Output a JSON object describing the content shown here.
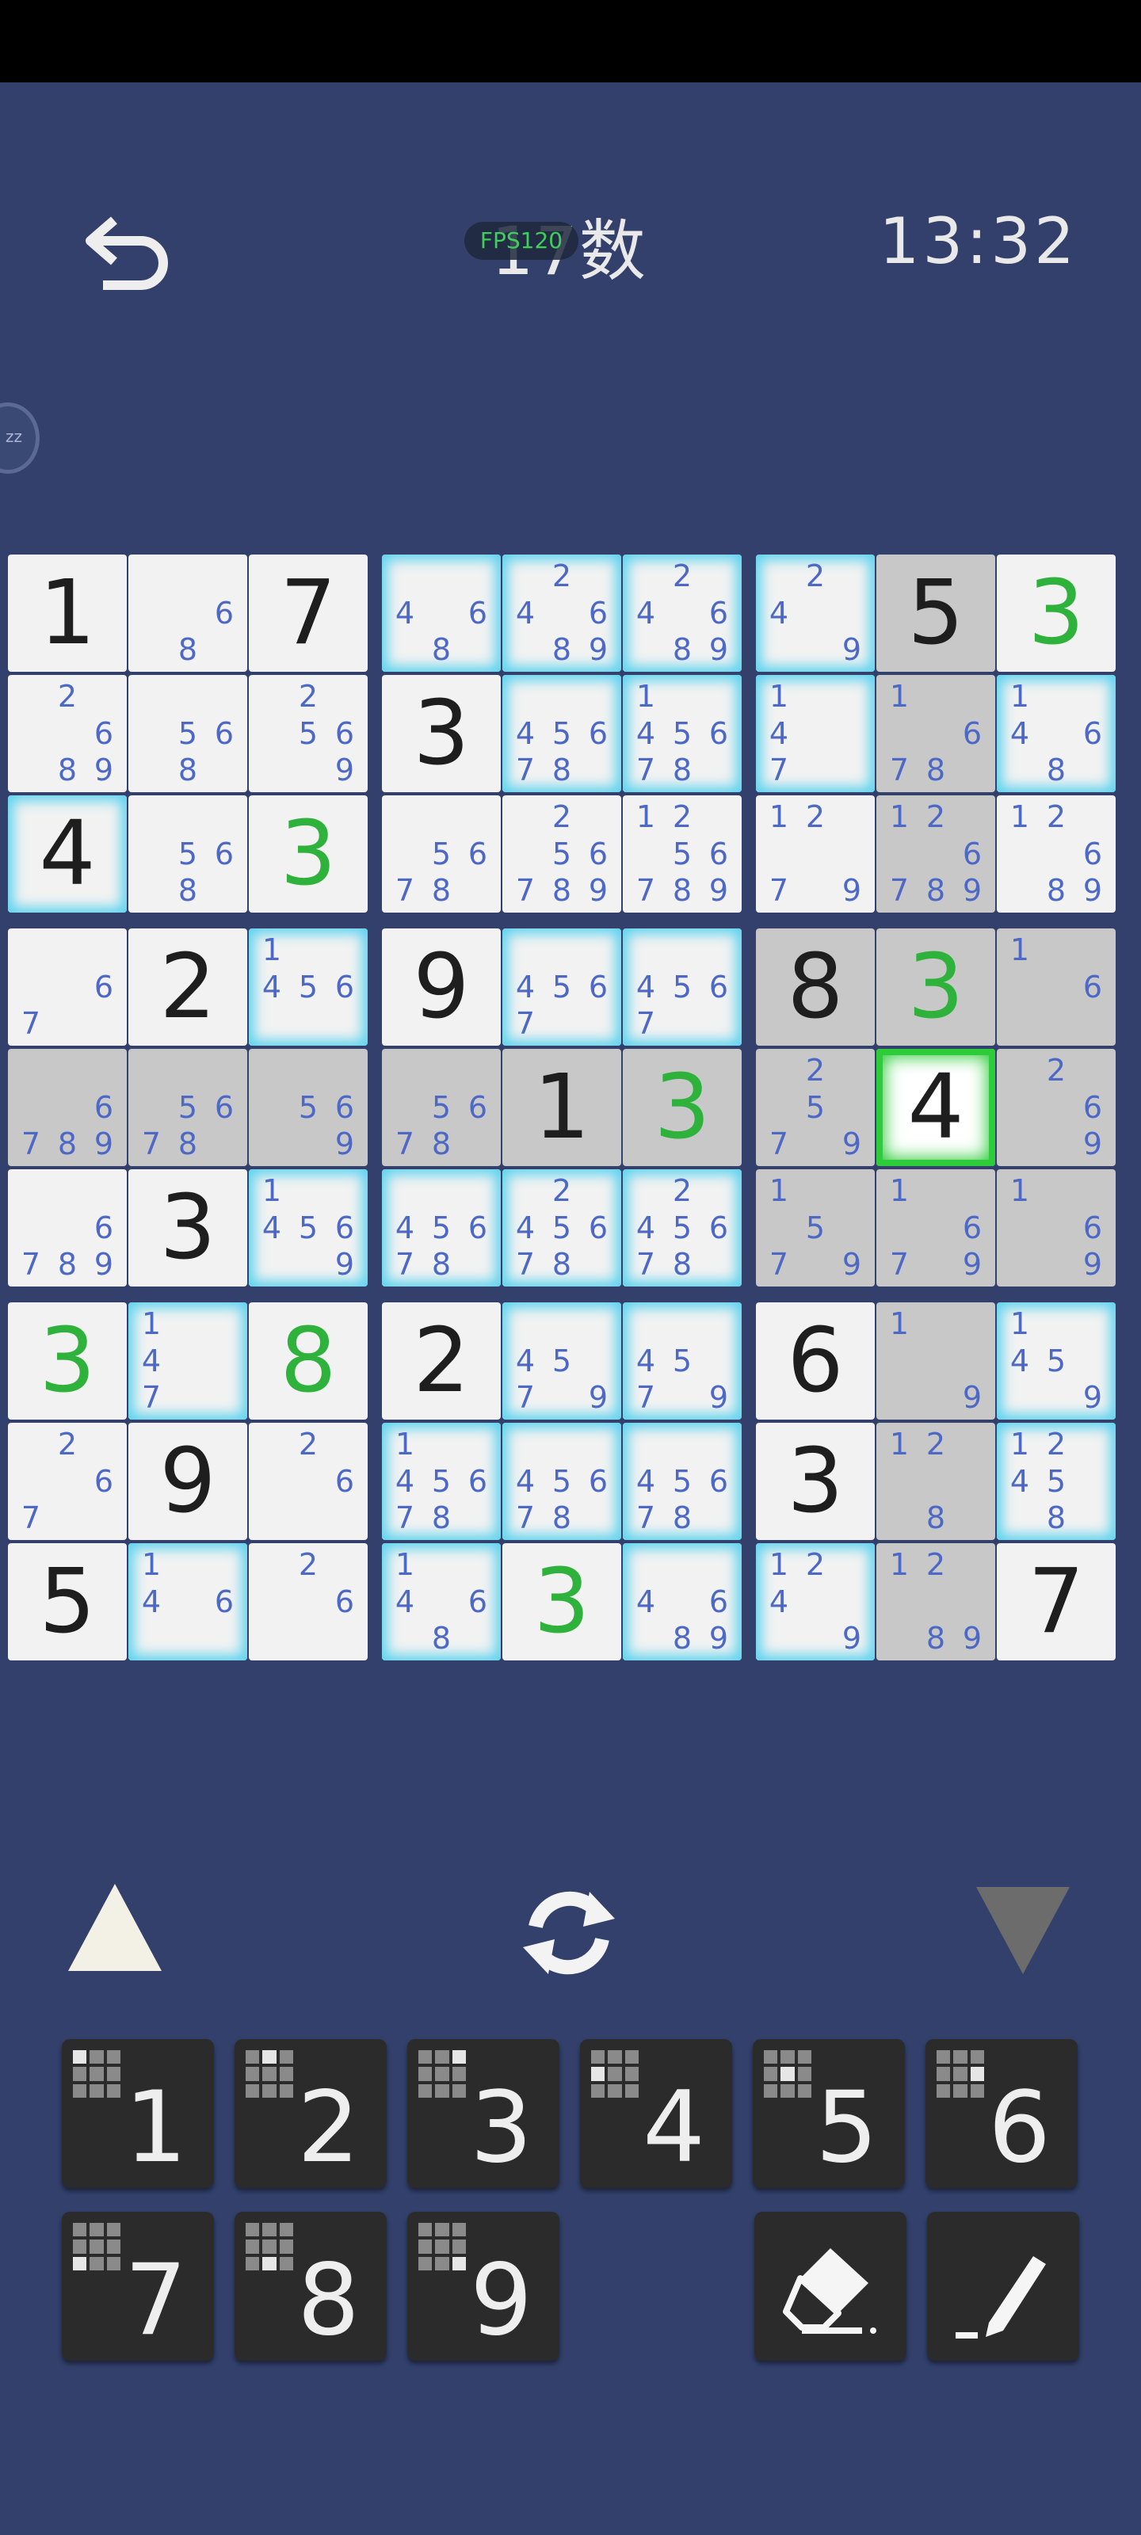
{
  "header": {
    "title": "17数",
    "fps_badge": "FPS120",
    "timer": "13:32",
    "side_badge": "zz"
  },
  "board": {
    "cells": [
      {
        "v": "1",
        "g": false,
        "h": false,
        "grey": false,
        "notes": []
      },
      {
        "v": "",
        "g": false,
        "h": false,
        "grey": false,
        "notes": [
          6,
          8
        ]
      },
      {
        "v": "7",
        "g": false,
        "h": false,
        "grey": false,
        "notes": []
      },
      {
        "v": "",
        "g": false,
        "h": true,
        "grey": false,
        "notes": [
          4,
          6,
          8
        ]
      },
      {
        "v": "",
        "g": false,
        "h": true,
        "grey": false,
        "notes": [
          2,
          4,
          6,
          8,
          9
        ]
      },
      {
        "v": "",
        "g": false,
        "h": true,
        "grey": false,
        "notes": [
          2,
          4,
          6,
          8,
          9
        ]
      },
      {
        "v": "",
        "g": false,
        "h": true,
        "grey": false,
        "notes": [
          2,
          4,
          9
        ]
      },
      {
        "v": "5",
        "g": false,
        "h": false,
        "grey": true,
        "notes": []
      },
      {
        "v": "3",
        "g": true,
        "h": false,
        "grey": false,
        "notes": []
      },
      {
        "v": "",
        "g": false,
        "h": false,
        "grey": false,
        "notes": [
          2,
          6,
          8,
          9
        ]
      },
      {
        "v": "",
        "g": false,
        "h": false,
        "grey": false,
        "notes": [
          5,
          6,
          8
        ]
      },
      {
        "v": "",
        "g": false,
        "h": false,
        "grey": false,
        "notes": [
          2,
          5,
          6,
          9
        ]
      },
      {
        "v": "3",
        "g": false,
        "h": false,
        "grey": false,
        "notes": []
      },
      {
        "v": "",
        "g": false,
        "h": true,
        "grey": false,
        "notes": [
          4,
          5,
          6,
          7,
          8
        ]
      },
      {
        "v": "",
        "g": false,
        "h": true,
        "grey": false,
        "notes": [
          1,
          4,
          5,
          6,
          7,
          8
        ]
      },
      {
        "v": "",
        "g": false,
        "h": true,
        "grey": false,
        "notes": [
          1,
          4,
          7
        ]
      },
      {
        "v": "",
        "g": false,
        "h": false,
        "grey": true,
        "notes": [
          1,
          6,
          7,
          8
        ]
      },
      {
        "v": "",
        "g": false,
        "h": true,
        "grey": false,
        "notes": [
          1,
          4,
          6,
          8
        ]
      },
      {
        "v": "4",
        "g": false,
        "h": true,
        "grey": false,
        "notes": []
      },
      {
        "v": "",
        "g": false,
        "h": false,
        "grey": false,
        "notes": [
          5,
          6,
          8
        ]
      },
      {
        "v": "3",
        "g": true,
        "h": false,
        "grey": false,
        "notes": []
      },
      {
        "v": "",
        "g": false,
        "h": false,
        "grey": false,
        "notes": [
          5,
          6,
          7,
          8
        ]
      },
      {
        "v": "",
        "g": false,
        "h": false,
        "grey": false,
        "notes": [
          2,
          5,
          6,
          7,
          8,
          9
        ]
      },
      {
        "v": "",
        "g": false,
        "h": false,
        "grey": false,
        "notes": [
          1,
          2,
          5,
          6,
          7,
          8,
          9
        ]
      },
      {
        "v": "",
        "g": false,
        "h": false,
        "grey": false,
        "notes": [
          1,
          2,
          7,
          9
        ]
      },
      {
        "v": "",
        "g": false,
        "h": false,
        "grey": true,
        "notes": [
          1,
          2,
          6,
          7,
          8,
          9
        ]
      },
      {
        "v": "",
        "g": false,
        "h": false,
        "grey": false,
        "notes": [
          1,
          2,
          6,
          8,
          9
        ]
      },
      {
        "v": "",
        "g": false,
        "h": false,
        "grey": false,
        "notes": [
          6,
          7
        ]
      },
      {
        "v": "2",
        "g": false,
        "h": false,
        "grey": false,
        "notes": []
      },
      {
        "v": "",
        "g": false,
        "h": true,
        "grey": false,
        "notes": [
          1,
          4,
          5,
          6
        ]
      },
      {
        "v": "9",
        "g": false,
        "h": false,
        "grey": false,
        "notes": []
      },
      {
        "v": "",
        "g": false,
        "h": true,
        "grey": false,
        "notes": [
          4,
          5,
          6,
          7
        ]
      },
      {
        "v": "",
        "g": false,
        "h": true,
        "grey": false,
        "notes": [
          4,
          5,
          6,
          7
        ]
      },
      {
        "v": "8",
        "g": false,
        "h": false,
        "grey": true,
        "notes": []
      },
      {
        "v": "3",
        "g": true,
        "h": false,
        "grey": true,
        "notes": []
      },
      {
        "v": "",
        "g": false,
        "h": false,
        "grey": true,
        "notes": [
          1,
          6
        ]
      },
      {
        "v": "",
        "g": false,
        "h": false,
        "grey": true,
        "notes": [
          6,
          7,
          8,
          9
        ]
      },
      {
        "v": "",
        "g": false,
        "h": false,
        "grey": true,
        "notes": [
          5,
          6,
          7,
          8
        ]
      },
      {
        "v": "",
        "g": false,
        "h": false,
        "grey": true,
        "notes": [
          5,
          6,
          9
        ]
      },
      {
        "v": "",
        "g": false,
        "h": false,
        "grey": true,
        "notes": [
          5,
          6,
          7,
          8
        ]
      },
      {
        "v": "1",
        "g": false,
        "h": false,
        "grey": true,
        "notes": []
      },
      {
        "v": "3",
        "g": true,
        "h": false,
        "grey": true,
        "notes": []
      },
      {
        "v": "",
        "g": false,
        "h": false,
        "grey": true,
        "notes": [
          2,
          5,
          7,
          9
        ]
      },
      {
        "v": "4",
        "g": false,
        "h": false,
        "grey": false,
        "sel": true,
        "notes": []
      },
      {
        "v": "",
        "g": false,
        "h": false,
        "grey": true,
        "notes": [
          2,
          6,
          9
        ]
      },
      {
        "v": "",
        "g": false,
        "h": false,
        "grey": false,
        "notes": [
          6,
          7,
          8,
          9
        ]
      },
      {
        "v": "3",
        "g": false,
        "h": false,
        "grey": false,
        "notes": []
      },
      {
        "v": "",
        "g": false,
        "h": true,
        "grey": false,
        "notes": [
          1,
          4,
          5,
          6,
          9
        ]
      },
      {
        "v": "",
        "g": false,
        "h": true,
        "grey": false,
        "notes": [
          4,
          5,
          6,
          7,
          8
        ]
      },
      {
        "v": "",
        "g": false,
        "h": true,
        "grey": false,
        "notes": [
          2,
          4,
          5,
          6,
          7,
          8
        ]
      },
      {
        "v": "",
        "g": false,
        "h": true,
        "grey": false,
        "notes": [
          2,
          4,
          5,
          6,
          7,
          8
        ]
      },
      {
        "v": "",
        "g": false,
        "h": false,
        "grey": true,
        "notes": [
          1,
          5,
          7,
          9
        ]
      },
      {
        "v": "",
        "g": false,
        "h": false,
        "grey": true,
        "notes": [
          1,
          6,
          7,
          9
        ]
      },
      {
        "v": "",
        "g": false,
        "h": false,
        "grey": true,
        "notes": [
          1,
          6,
          9
        ]
      },
      {
        "v": "3",
        "g": true,
        "h": false,
        "grey": false,
        "notes": []
      },
      {
        "v": "",
        "g": false,
        "h": true,
        "grey": false,
        "notes": [
          1,
          4,
          7
        ]
      },
      {
        "v": "8",
        "g": true,
        "h": false,
        "grey": false,
        "notes": []
      },
      {
        "v": "2",
        "g": false,
        "h": false,
        "grey": false,
        "notes": []
      },
      {
        "v": "",
        "g": false,
        "h": true,
        "grey": false,
        "notes": [
          4,
          5,
          7,
          9
        ]
      },
      {
        "v": "",
        "g": false,
        "h": true,
        "grey": false,
        "notes": [
          4,
          5,
          7,
          9
        ]
      },
      {
        "v": "6",
        "g": false,
        "h": false,
        "grey": false,
        "notes": []
      },
      {
        "v": "",
        "g": false,
        "h": false,
        "grey": true,
        "notes": [
          1,
          9
        ]
      },
      {
        "v": "",
        "g": false,
        "h": true,
        "grey": false,
        "notes": [
          1,
          4,
          5,
          9
        ]
      },
      {
        "v": "",
        "g": false,
        "h": false,
        "grey": false,
        "notes": [
          2,
          6,
          7
        ]
      },
      {
        "v": "9",
        "g": false,
        "h": false,
        "grey": false,
        "notes": []
      },
      {
        "v": "",
        "g": false,
        "h": false,
        "grey": false,
        "notes": [
          2,
          6
        ]
      },
      {
        "v": "",
        "g": false,
        "h": true,
        "grey": false,
        "notes": [
          1,
          4,
          5,
          6,
          7,
          8
        ]
      },
      {
        "v": "",
        "g": false,
        "h": true,
        "grey": false,
        "notes": [
          4,
          5,
          6,
          7,
          8
        ]
      },
      {
        "v": "",
        "g": false,
        "h": true,
        "grey": false,
        "notes": [
          4,
          5,
          6,
          7,
          8
        ]
      },
      {
        "v": "3",
        "g": false,
        "h": false,
        "grey": false,
        "notes": []
      },
      {
        "v": "",
        "g": false,
        "h": false,
        "grey": true,
        "notes": [
          1,
          2,
          8
        ]
      },
      {
        "v": "",
        "g": false,
        "h": true,
        "grey": false,
        "notes": [
          1,
          2,
          4,
          5,
          8
        ]
      },
      {
        "v": "5",
        "g": false,
        "h": false,
        "grey": false,
        "notes": []
      },
      {
        "v": "",
        "g": false,
        "h": true,
        "grey": false,
        "notes": [
          1,
          4,
          6
        ]
      },
      {
        "v": "",
        "g": false,
        "h": false,
        "grey": false,
        "notes": [
          2,
          6
        ]
      },
      {
        "v": "",
        "g": false,
        "h": true,
        "grey": false,
        "notes": [
          1,
          4,
          6,
          8
        ]
      },
      {
        "v": "3",
        "g": true,
        "h": false,
        "grey": false,
        "notes": []
      },
      {
        "v": "",
        "g": false,
        "h": true,
        "grey": false,
        "notes": [
          4,
          6,
          8,
          9
        ]
      },
      {
        "v": "",
        "g": false,
        "h": true,
        "grey": false,
        "notes": [
          1,
          2,
          4,
          9
        ]
      },
      {
        "v": "",
        "g": false,
        "h": false,
        "grey": true,
        "notes": [
          1,
          2,
          8,
          9
        ]
      },
      {
        "v": "7",
        "g": false,
        "h": false,
        "grey": false,
        "notes": []
      }
    ]
  },
  "controls": {
    "icons": [
      "triangle-up-icon",
      "refresh-icon",
      "triangle-down-icon"
    ]
  },
  "keypad": {
    "keys": [
      {
        "label": "1",
        "dot": 0
      },
      {
        "label": "2",
        "dot": 1
      },
      {
        "label": "3",
        "dot": 2
      },
      {
        "label": "4",
        "dot": 3
      },
      {
        "label": "5",
        "dot": 4
      },
      {
        "label": "6",
        "dot": 5
      },
      {
        "label": "7",
        "dot": 6
      },
      {
        "label": "8",
        "dot": 7
      },
      {
        "label": "9",
        "dot": 8
      }
    ],
    "tools": [
      "eraser-icon",
      "pencil-icon"
    ]
  },
  "colors": {
    "background": "#32406b",
    "given_digit": "#1e1e1e",
    "placed_digit": "#2fb23c",
    "note": "#4d68c5",
    "highlight": "#5fd3ee",
    "selected": "#2ecc3a"
  }
}
